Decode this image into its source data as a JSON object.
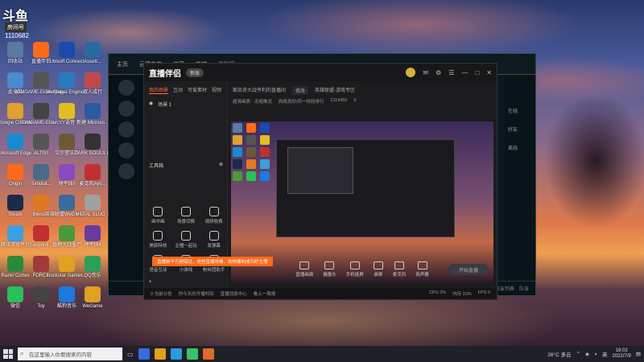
{
  "desktop": {
    "logo": "斗鱼",
    "room_label": "房间号",
    "room_number": "1110682",
    "icons": [
      {
        "label": "回收站",
        "color": "#5a7aa0"
      },
      {
        "label": "直播伴侣",
        "color": "#ff6a1a"
      },
      {
        "label": "Ubisoft Connect",
        "color": "#1a4ab0"
      },
      {
        "label": "Assett...",
        "color": "#2a6aa0"
      },
      {
        "label": "此电脑",
        "color": "#4a8ad0"
      },
      {
        "label": "3DMGAME-Elden Ring...",
        "color": "#555"
      },
      {
        "label": "Wallpaper Engine...",
        "color": "#2a7ac0"
      },
      {
        "label": "双人成行",
        "color": "#c04a4a"
      },
      {
        "label": "Google Chrome",
        "color": "#e0a030"
      },
      {
        "label": "3DMGAME-Elden...",
        "color": "#444"
      },
      {
        "label": "YY语音",
        "color": "#e0c020"
      },
      {
        "label": "新建 Microso...",
        "color": "#2a5aa0"
      },
      {
        "label": "Microsoft Edge",
        "color": "#1a8ad0"
      },
      {
        "label": "ALTIVI",
        "color": "#555"
      },
      {
        "label": "艾尔登法环",
        "color": "#6a5a3a"
      },
      {
        "label": "DARK SOULS III",
        "color": "#333"
      },
      {
        "label": "Origin",
        "color": "#ff6a1a"
      },
      {
        "label": "Simulat...",
        "color": "#4a6a8a"
      },
      {
        "label": "地平线5",
        "color": "#8a4ac0"
      },
      {
        "label": "麦克风Ayo...",
        "color": "#c03030"
      },
      {
        "label": "Steam",
        "color": "#1a2a4a"
      },
      {
        "label": "Blender",
        "color": "#e07a20"
      },
      {
        "label": "英雄联盟WeGame...",
        "color": "#3a6aa0"
      },
      {
        "label": "METAL SLUG X",
        "color": "#a0a0a0"
      },
      {
        "label": "腾讯游戏平台",
        "color": "#3aa0e0"
      },
      {
        "label": "EasyAnti...",
        "color": "#c03030"
      },
      {
        "label": "植物大战僵尸",
        "color": "#4a9a3a"
      },
      {
        "label": "地平线4",
        "color": "#6a3aa0"
      },
      {
        "label": "Razer Cortex",
        "color": "#2a8a3a"
      },
      {
        "label": "FORCE",
        "color": "#a03a3a"
      },
      {
        "label": "Rockstar Games...",
        "color": "#e0a020"
      },
      {
        "label": "QQ音乐",
        "color": "#2aa05a"
      },
      {
        "label": "微信",
        "color": "#2ac05a"
      },
      {
        "label": "Toy",
        "color": "#444"
      },
      {
        "label": "酷狗音乐",
        "color": "#1a7ae0"
      },
      {
        "label": "WeGame",
        "color": "#e0a020"
      }
    ]
  },
  "lol_client": {
    "nav_items": [
      "主页",
      "云顶之弈",
      "收藏",
      "商城",
      "战利品"
    ],
    "right_panel": [
      "在线",
      "好友",
      "离线"
    ],
    "status": [
      "聊天",
      "好友列表",
      "队伍"
    ]
  },
  "app": {
    "name": "直播伴侣",
    "badge": "新版",
    "source_tabs": [
      "我的场景",
      "互动",
      "可爱素材",
      "视频"
    ],
    "scene_name": "场景 1",
    "tools_heading": "工具箱",
    "promo_text": "直播前千万别错过，这些直播攻略，助你顺利成为好主播",
    "tools": [
      {
        "label": "画中画"
      },
      {
        "label": "场景切换"
      },
      {
        "label": "视频收费"
      },
      {
        "label": "美颜特效"
      },
      {
        "label": "主播一起玩"
      },
      {
        "label": "发弹幕"
      },
      {
        "label": "语音互动"
      },
      {
        "label": "小游戏"
      },
      {
        "label": "粉丝团助手"
      }
    ],
    "add_button": "+",
    "info": {
      "title": "斯凯奇大战亨利的直播间",
      "tag": "修改",
      "category": "英雄联盟-游戏专区",
      "clarity": "超清画质 · 无缝推流",
      "network": "网络良好/同一时段排行",
      "rank": "2119450",
      "viewers": "0"
    },
    "bottom_toolbar": [
      {
        "label": "直播画面"
      },
      {
        "label": "摄像头"
      },
      {
        "label": "手机投屏"
      },
      {
        "label": "录屏"
      },
      {
        "label": "麦克风"
      },
      {
        "label": "扬声器"
      }
    ],
    "go_live": "开始直播",
    "status": {
      "left": [
        "0 当前公告",
        "你今天的开播时间",
        "直播消息中心",
        "看上一周报"
      ],
      "right": [
        "CPU 2%",
        "内存 33%",
        "FPS 0"
      ]
    }
  },
  "taskbar": {
    "search_placeholder": "在这里输入你要搜索的内容",
    "apps": [
      "#3a6ae0",
      "#e0a020",
      "#2a9ae0",
      "#3ac06a",
      "#e06a2a"
    ],
    "weather": "26°C 多云",
    "lang": "英",
    "time": "18:02",
    "date": "2022/7/9"
  },
  "colors": {
    "accent": "#ff6a3a",
    "promo": "#ff6a1a"
  }
}
